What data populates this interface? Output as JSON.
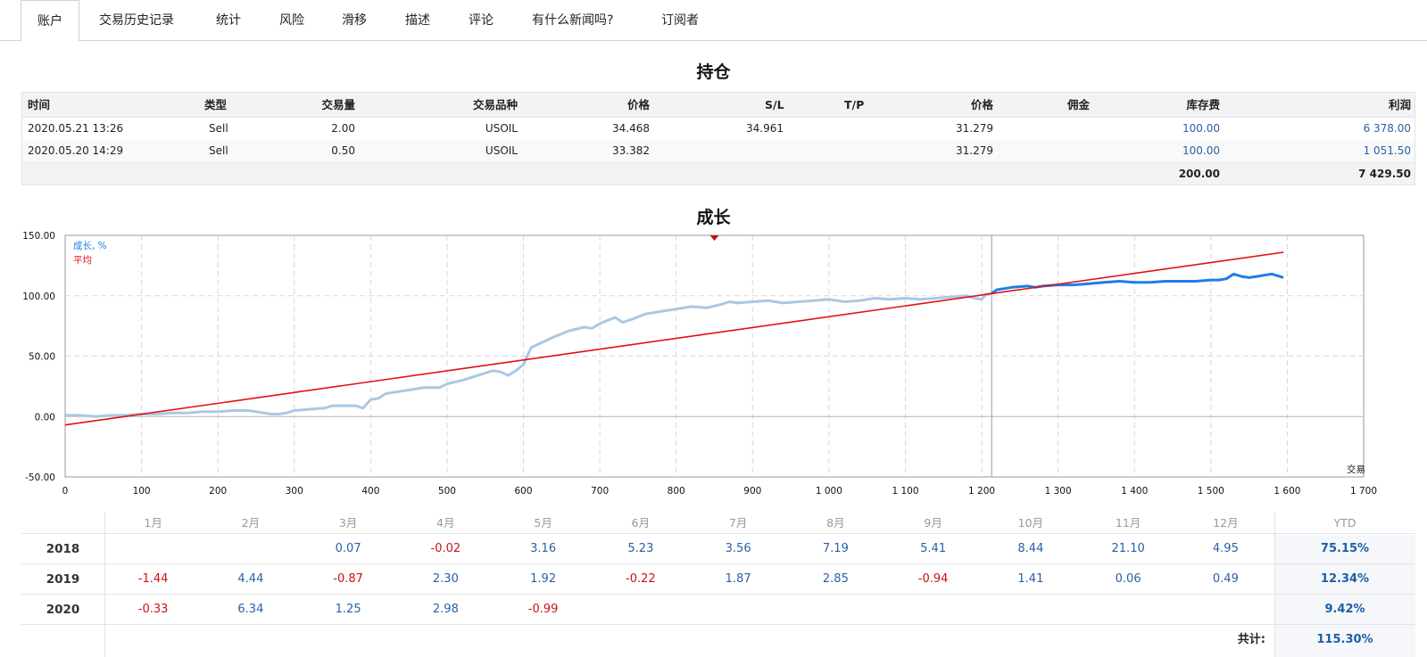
{
  "tabs": [
    {
      "label": "账户",
      "active": true
    },
    {
      "label": "交易历史记录"
    },
    {
      "label": "统计"
    },
    {
      "label": "风险"
    },
    {
      "label": "滑移"
    },
    {
      "label": "描述"
    },
    {
      "label": "评论"
    },
    {
      "label": "有什么新闻吗?"
    },
    {
      "label": "订阅者"
    }
  ],
  "positions": {
    "title": "持仓",
    "headers": [
      "时间",
      "类型",
      "交易量",
      "交易品种",
      "价格",
      "S/L",
      "T/P",
      "价格",
      "佣金",
      "库存费",
      "利润"
    ],
    "rows": [
      [
        "2020.05.21 13:26",
        "Sell",
        "2.00",
        "USOIL",
        "34.468",
        "34.961",
        "",
        "31.279",
        "",
        "100.00",
        "6 378.00"
      ],
      [
        "2020.05.20 14:29",
        "Sell",
        "0.50",
        "USOIL",
        "33.382",
        "",
        "",
        "31.279",
        "",
        "100.00",
        "1 051.50"
      ]
    ],
    "total": {
      "swap": "200.00",
      "profit": "7 429.50"
    }
  },
  "growth": {
    "title": "成长",
    "legend_growth": "成长, %",
    "legend_avg": "平均",
    "x_axis_caption": "交易",
    "colors": {
      "history": "#aac8e4",
      "recent": "#1e7ee8",
      "average": "#e01010",
      "axis_text": "#111"
    }
  },
  "chart_data": {
    "type": "line",
    "xlim": [
      0,
      1700
    ],
    "ylim": [
      -50,
      150
    ],
    "x_ticks": [
      "0",
      "100",
      "200",
      "300",
      "400",
      "500",
      "600",
      "700",
      "800",
      "900",
      "1 000",
      "1 100",
      "1 200",
      "1 300",
      "1 400",
      "1 500",
      "1 600",
      "1 700"
    ],
    "y_ticks": [
      "150.00",
      "100.00",
      "50.00",
      "0.00",
      "-50.00"
    ],
    "y_tick_values": [
      150,
      100,
      50,
      0,
      -50
    ],
    "x_tick_values": [
      0,
      100,
      200,
      300,
      400,
      500,
      600,
      700,
      800,
      900,
      1000,
      1100,
      1200,
      1300,
      1400,
      1500,
      1600,
      1700
    ],
    "split_x": 1213,
    "marker_x": 850,
    "series": [
      {
        "name": "成长, %",
        "history_points": [
          [
            0,
            1
          ],
          [
            20,
            1
          ],
          [
            40,
            0
          ],
          [
            60,
            1
          ],
          [
            80,
            1
          ],
          [
            100,
            2
          ],
          [
            120,
            2
          ],
          [
            140,
            3
          ],
          [
            160,
            3
          ],
          [
            180,
            4
          ],
          [
            200,
            4
          ],
          [
            220,
            5
          ],
          [
            240,
            5
          ],
          [
            250,
            4
          ],
          [
            260,
            3
          ],
          [
            270,
            2
          ],
          [
            280,
            2
          ],
          [
            290,
            3
          ],
          [
            300,
            5
          ],
          [
            320,
            6
          ],
          [
            340,
            7
          ],
          [
            350,
            9
          ],
          [
            370,
            9
          ],
          [
            380,
            9
          ],
          [
            390,
            7
          ],
          [
            400,
            14
          ],
          [
            410,
            15
          ],
          [
            420,
            19
          ],
          [
            440,
            21
          ],
          [
            460,
            23
          ],
          [
            470,
            24
          ],
          [
            490,
            24
          ],
          [
            500,
            27
          ],
          [
            520,
            30
          ],
          [
            540,
            34
          ],
          [
            560,
            38
          ],
          [
            570,
            37
          ],
          [
            580,
            34
          ],
          [
            590,
            38
          ],
          [
            600,
            43
          ],
          [
            610,
            57
          ],
          [
            620,
            60
          ],
          [
            640,
            66
          ],
          [
            660,
            71
          ],
          [
            680,
            74
          ],
          [
            690,
            73
          ],
          [
            700,
            77
          ],
          [
            720,
            82
          ],
          [
            730,
            78
          ],
          [
            740,
            80
          ],
          [
            760,
            85
          ],
          [
            780,
            87
          ],
          [
            800,
            89
          ],
          [
            820,
            91
          ],
          [
            840,
            90
          ],
          [
            860,
            93
          ],
          [
            870,
            95
          ],
          [
            880,
            94
          ],
          [
            900,
            95
          ],
          [
            920,
            96
          ],
          [
            940,
            94
          ],
          [
            960,
            95
          ],
          [
            980,
            96
          ],
          [
            1000,
            97
          ],
          [
            1020,
            95
          ],
          [
            1040,
            96
          ],
          [
            1060,
            98
          ],
          [
            1080,
            97
          ],
          [
            1100,
            98
          ],
          [
            1120,
            97
          ],
          [
            1140,
            98
          ],
          [
            1160,
            99
          ],
          [
            1180,
            100
          ],
          [
            1190,
            98
          ],
          [
            1200,
            97
          ],
          [
            1205,
            101
          ],
          [
            1213,
            102
          ]
        ],
        "recent_points": [
          [
            1213,
            102
          ],
          [
            1220,
            105
          ],
          [
            1240,
            107
          ],
          [
            1260,
            108
          ],
          [
            1270,
            107
          ],
          [
            1280,
            108
          ],
          [
            1300,
            109
          ],
          [
            1320,
            109
          ],
          [
            1340,
            110
          ],
          [
            1360,
            111
          ],
          [
            1380,
            112
          ],
          [
            1400,
            111
          ],
          [
            1420,
            111
          ],
          [
            1440,
            112
          ],
          [
            1460,
            112
          ],
          [
            1480,
            112
          ],
          [
            1500,
            113
          ],
          [
            1510,
            113
          ],
          [
            1520,
            114
          ],
          [
            1530,
            118
          ],
          [
            1540,
            116
          ],
          [
            1550,
            115
          ],
          [
            1560,
            116
          ],
          [
            1570,
            117
          ],
          [
            1580,
            118
          ],
          [
            1590,
            116
          ],
          [
            1595,
            115
          ]
        ]
      },
      {
        "name": "平均",
        "points": [
          [
            0,
            -7
          ],
          [
            1595,
            136
          ]
        ]
      }
    ]
  },
  "monthly": {
    "months": [
      "1月",
      "2月",
      "3月",
      "4月",
      "5月",
      "6月",
      "7月",
      "8月",
      "9月",
      "10月",
      "11月",
      "12月"
    ],
    "ytd_label": "YTD",
    "rows": [
      {
        "year": "2018",
        "values": [
          "",
          "",
          "0.07",
          "-0.02",
          "3.16",
          "5.23",
          "3.56",
          "7.19",
          "5.41",
          "8.44",
          "21.10",
          "4.95"
        ],
        "ytd": "75.15%"
      },
      {
        "year": "2019",
        "values": [
          "-1.44",
          "4.44",
          "-0.87",
          "2.30",
          "1.92",
          "-0.22",
          "1.87",
          "2.85",
          "-0.94",
          "1.41",
          "0.06",
          "0.49"
        ],
        "ytd": "12.34%"
      },
      {
        "year": "2020",
        "values": [
          "-0.33",
          "6.34",
          "1.25",
          "2.98",
          "-0.99",
          "",
          "",
          "",
          "",
          "",
          "",
          ""
        ],
        "ytd": "9.42%"
      }
    ],
    "total_label": "共计:",
    "total_value": "115.30%"
  }
}
